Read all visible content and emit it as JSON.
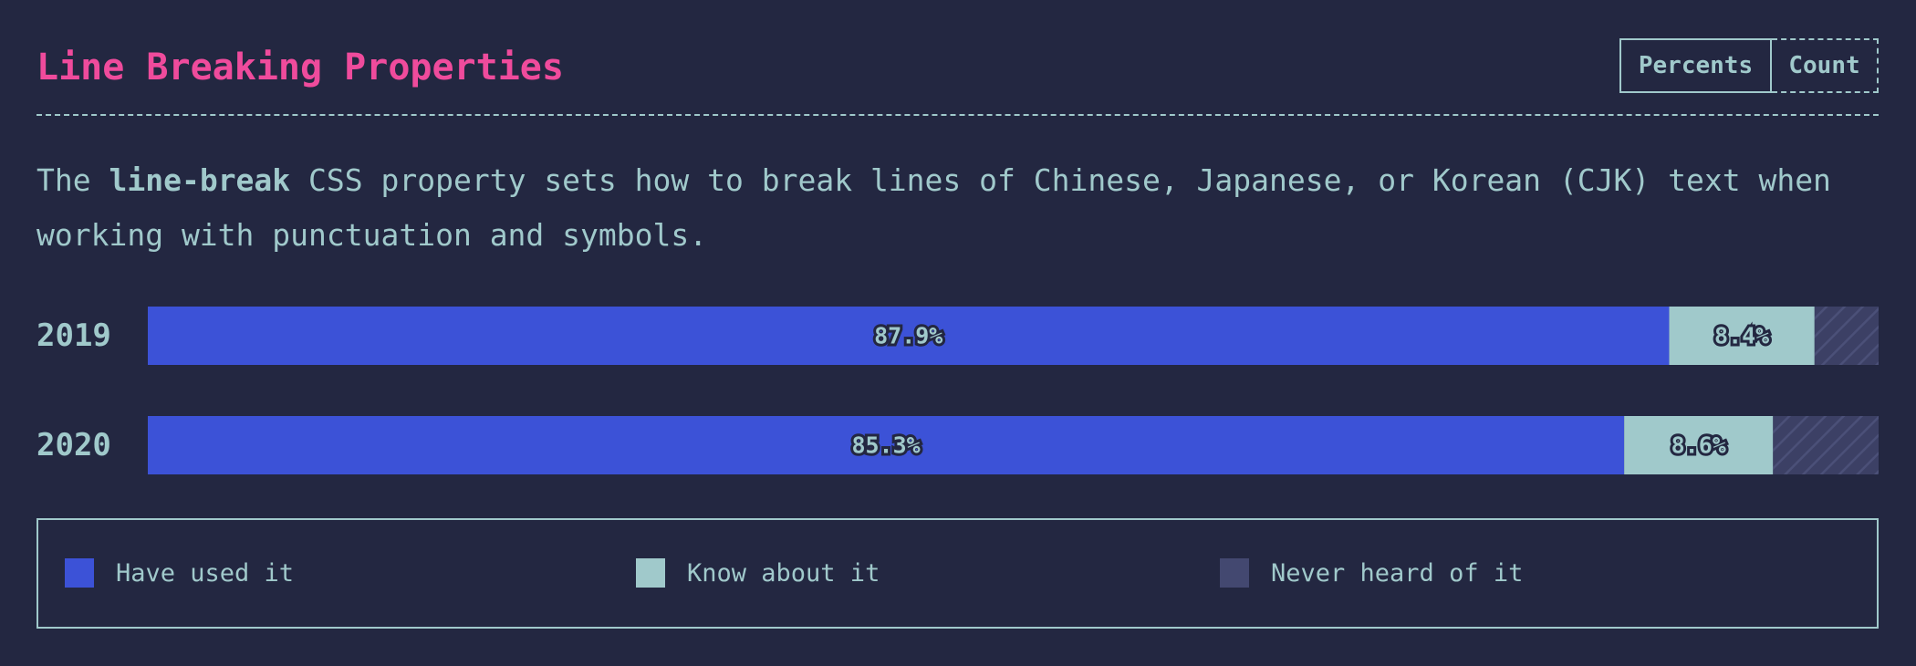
{
  "title": "Line Breaking Properties",
  "toggle": {
    "percents_label": "Percents",
    "count_label": "Count"
  },
  "description": {
    "before": "The ",
    "code": "line-break",
    "after": " CSS property sets how to break lines of Chinese, Japanese, or Korean (CJK) text when working with punctuation and symbols."
  },
  "chart_data": {
    "type": "bar",
    "orientation": "horizontal",
    "stacked": true,
    "categories": [
      "2019",
      "2020"
    ],
    "series": [
      {
        "name": "Have used it",
        "values": [
          87.9,
          85.3
        ],
        "labels": [
          "87.9%",
          "85.3%"
        ],
        "color": "#3c52d7"
      },
      {
        "name": "Know about it",
        "values": [
          8.4,
          8.6
        ],
        "labels": [
          "8.4%",
          "8.6%"
        ],
        "color": "#a0c9cb"
      },
      {
        "name": "Never heard of it",
        "values": [
          3.7,
          6.1
        ],
        "labels": [
          "",
          ""
        ],
        "color": "#434870"
      }
    ],
    "xlim": [
      0,
      100
    ],
    "legend": "bottom"
  },
  "legend": {
    "items": [
      {
        "label": "Have used it",
        "color": "#3c52d7"
      },
      {
        "label": "Know about it",
        "color": "#a0c9cb"
      },
      {
        "label": "Never heard of it",
        "color": "#434870"
      }
    ]
  }
}
